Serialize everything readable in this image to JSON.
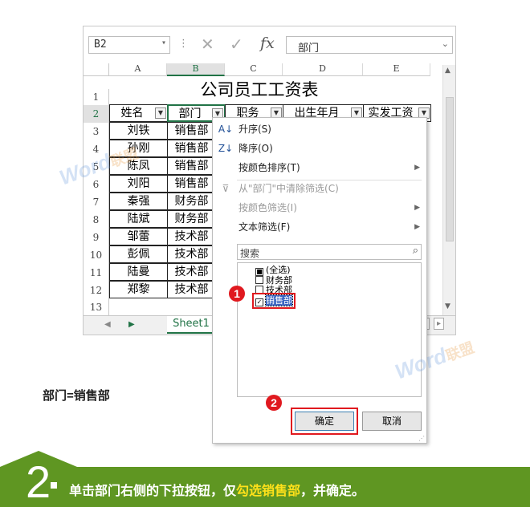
{
  "formula_bar": {
    "name_box": "B2",
    "fx": "fx",
    "value": "部门"
  },
  "columns": [
    "A",
    "B",
    "C",
    "D",
    "E"
  ],
  "rows": [
    "1",
    "2",
    "3",
    "4",
    "5",
    "6",
    "7",
    "8",
    "9",
    "10",
    "11",
    "12",
    "13"
  ],
  "sheet_title": "公司员工工资表",
  "headers": [
    "姓名",
    "部门",
    "职务",
    "出生年月",
    "实发工资"
  ],
  "names": [
    "刘铁",
    "孙刚",
    "陈凤",
    "刘阳",
    "秦强",
    "陆斌",
    "邹蕾",
    "彭佩",
    "陆曼",
    "郑黎"
  ],
  "depts": [
    "销售部",
    "销售部",
    "销售部",
    "销售部",
    "财务部",
    "财务部",
    "技术部",
    "技术部",
    "技术部",
    "技术部"
  ],
  "sheet_tab": "Sheet1",
  "menu": {
    "sort_asc": "升序(S)",
    "sort_desc": "降序(O)",
    "sort_color": "按颜色排序(T)",
    "clear_filter": "从\"部门\"中清除筛选(C)",
    "filter_color": "按颜色筛选(I)",
    "text_filter": "文本筛选(F)",
    "search_placeholder": "搜索",
    "items": [
      {
        "label": "(全选)",
        "state": "partial"
      },
      {
        "label": "财务部",
        "state": "unchecked"
      },
      {
        "label": "技术部",
        "state": "unchecked"
      },
      {
        "label": "销售部",
        "state": "checked"
      }
    ],
    "ok": "确定",
    "cancel": "取消"
  },
  "markers": [
    "1",
    "2"
  ],
  "watermark": {
    "latin": "Word",
    "cjk": "联盟"
  },
  "caption": "部门=销售部",
  "banner": {
    "step": "2",
    "part1": "单击部门右侧的下拉按钮，仅",
    "highlight": "勾选销售部",
    "part2": "，并确定。"
  },
  "colors": {
    "excel_green": "#217346",
    "banner_green": "#5f9622",
    "highlight_yellow": "#ffe11a",
    "marker_red": "#e0191f"
  }
}
